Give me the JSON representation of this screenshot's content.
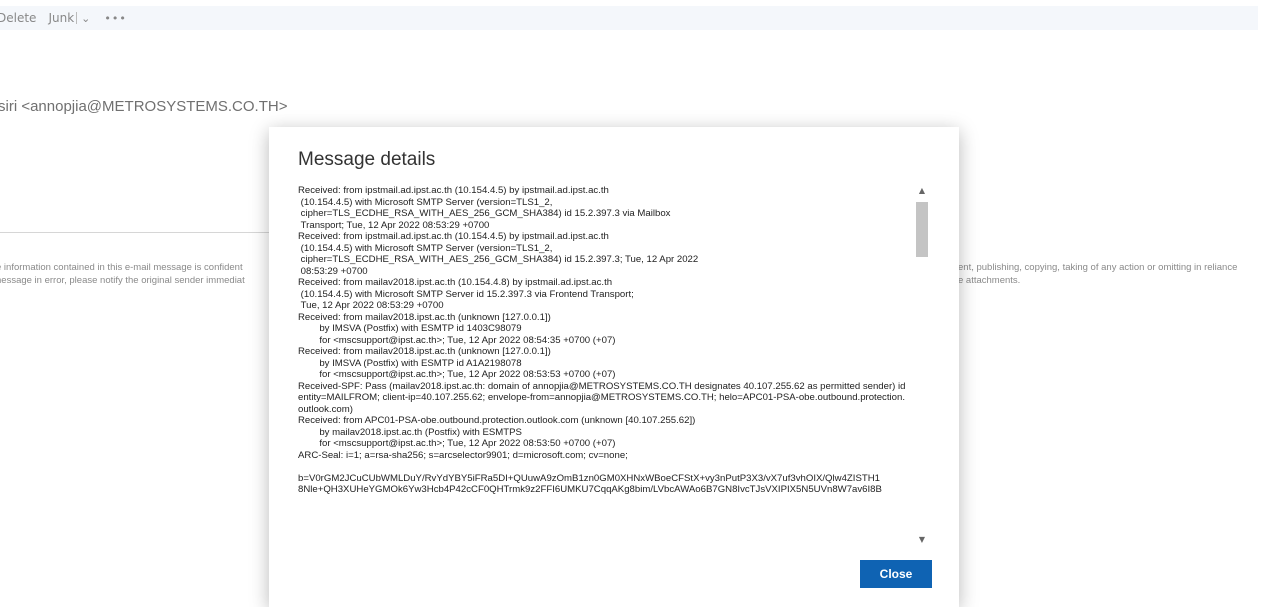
{
  "toolbar": {
    "delete_label": "Delete",
    "junk_label": "Junk",
    "chevron_glyph": "⌄",
    "more_glyph": "•••"
  },
  "message": {
    "sender": "siri <annopjia@METROSYSTEMS.CO.TH>",
    "disclaimer_left_1": "e information contained in this e-mail message is confident",
    "disclaimer_left_2": "nessage in error, please notify the original sender immediat",
    "disclaimer_right_1": "ent, publishing, copying, taking of any action or omitting in reliance",
    "disclaimer_right_2": "e attachments."
  },
  "dialog": {
    "title": "Message details",
    "headers": "Received: from ipstmail.ad.ipst.ac.th (10.154.4.5) by ipstmail.ad.ipst.ac.th\n (10.154.4.5) with Microsoft SMTP Server (version=TLS1_2,\n cipher=TLS_ECDHE_RSA_WITH_AES_256_GCM_SHA384) id 15.2.397.3 via Mailbox\n Transport; Tue, 12 Apr 2022 08:53:29 +0700\nReceived: from ipstmail.ad.ipst.ac.th (10.154.4.5) by ipstmail.ad.ipst.ac.th\n (10.154.4.5) with Microsoft SMTP Server (version=TLS1_2,\n cipher=TLS_ECDHE_RSA_WITH_AES_256_GCM_SHA384) id 15.2.397.3; Tue, 12 Apr 2022\n 08:53:29 +0700\nReceived: from mailav2018.ipst.ac.th (10.154.4.8) by ipstmail.ad.ipst.ac.th\n (10.154.4.5) with Microsoft SMTP Server id 15.2.397.3 via Frontend Transport;\n Tue, 12 Apr 2022 08:53:29 +0700\nReceived: from mailav2018.ipst.ac.th (unknown [127.0.0.1])\n        by IMSVA (Postfix) with ESMTP id 1403C98079\n        for <mscsupport@ipst.ac.th>; Tue, 12 Apr 2022 08:54:35 +0700 (+07)\nReceived: from mailav2018.ipst.ac.th (unknown [127.0.0.1])\n        by IMSVA (Postfix) with ESMTP id A1A2198078\n        for <mscsupport@ipst.ac.th>; Tue, 12 Apr 2022 08:53:53 +0700 (+07)\nReceived-SPF: Pass (mailav2018.ipst.ac.th: domain of annopjia@METROSYSTEMS.CO.TH designates 40.107.255.62 as permitted sender) identity=MAILFROM; client-ip=40.107.255.62; envelope-from=annopjia@METROSYSTEMS.CO.TH; helo=APC01-PSA-obe.outbound.protection.outlook.com)\nReceived: from APC01-PSA-obe.outbound.protection.outlook.com (unknown [40.107.255.62])\n        by mailav2018.ipst.ac.th (Postfix) with ESMTPS\n        for <mscsupport@ipst.ac.th>; Tue, 12 Apr 2022 08:53:50 +0700 (+07)\nARC-Seal: i=1; a=rsa-sha256; s=arcselector9901; d=microsoft.com; cv=none;\n\nb=V0rGM2JCuCUbWMLDuY/RvYdYBY5iFRa5DI+QUuwA9zOmB1zn0GM0XHNxWBoeCFStX+vy3nPutP3X3/vX7uf3vhOIX/Qlw4ZISTH1\n8Nle+QH3XUHeYGMOk6Yw3Hcb4P42cCF0QHTrmk9z2FFI6UMKU7CqqAKg8bim/LVbcAWAo6B7GN8IvcTJsVXIPIX5N5UVn8W7av6I8B",
    "close_label": "Close",
    "scroll_up_glyph": "▲",
    "scroll_down_glyph": "▼"
  }
}
